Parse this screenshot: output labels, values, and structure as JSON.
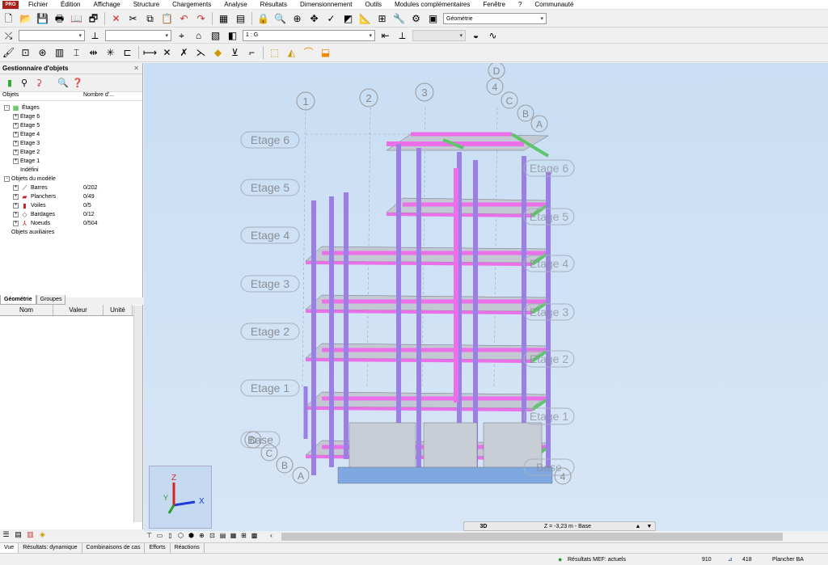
{
  "menu": {
    "logo": "PRO",
    "items": [
      "Fichier",
      "Édition",
      "Affichage",
      "Structure",
      "Chargements",
      "Analyse",
      "Résultats",
      "Dimensionnement",
      "Outils",
      "Modules complémentaires",
      "Fenêtre",
      "?",
      "Communauté"
    ]
  },
  "toolbar": {
    "layout_combo": "Géométrie",
    "case_combo": "1 : G"
  },
  "object_manager": {
    "title": "Gestionnaire d'objets",
    "col_objects": "Objets",
    "col_count": "Nombre d'...",
    "tree": [
      {
        "label": "Étages",
        "level": 0,
        "sign": "-",
        "icon": "floors-icon",
        "count": ""
      },
      {
        "label": "Etage 6",
        "level": 1,
        "sign": "+",
        "icon": "",
        "count": ""
      },
      {
        "label": "Etage 5",
        "level": 1,
        "sign": "+",
        "icon": "",
        "count": ""
      },
      {
        "label": "Etage 4",
        "level": 1,
        "sign": "+",
        "icon": "",
        "count": ""
      },
      {
        "label": "Etage 3",
        "level": 1,
        "sign": "+",
        "icon": "",
        "count": ""
      },
      {
        "label": "Etage 2",
        "level": 1,
        "sign": "+",
        "icon": "",
        "count": ""
      },
      {
        "label": "Etage 1",
        "level": 1,
        "sign": "+",
        "icon": "",
        "count": ""
      },
      {
        "label": "Indéfini",
        "level": 1,
        "sign": "",
        "icon": "",
        "count": ""
      },
      {
        "label": "Objets du modèle",
        "level": 0,
        "sign": "-",
        "icon": "",
        "count": ""
      },
      {
        "label": "Barres",
        "level": 1,
        "sign": "+",
        "icon": "bar-icon",
        "count": "0/202"
      },
      {
        "label": "Planchers",
        "level": 1,
        "sign": "+",
        "icon": "slab-icon",
        "count": "0/49"
      },
      {
        "label": "Voiles",
        "level": 1,
        "sign": "+",
        "icon": "wall-icon",
        "count": "0/5"
      },
      {
        "label": "Bardages",
        "level": 1,
        "sign": "+",
        "icon": "cladding-icon",
        "count": "0/12"
      },
      {
        "label": "Noeuds",
        "level": 1,
        "sign": "+",
        "icon": "node-icon",
        "count": "0/504"
      },
      {
        "label": "Objets auxiliaires",
        "level": 0,
        "sign": "",
        "icon": "",
        "count": ""
      }
    ],
    "tabs": [
      "Géométrie",
      "Groupes"
    ]
  },
  "properties": {
    "col_name": "Nom",
    "col_value": "Valeur",
    "col_unit": "Unité"
  },
  "viewport": {
    "axes_numbers": [
      "1",
      "2",
      "3",
      "4"
    ],
    "axes_letters": [
      "D",
      "C",
      "B",
      "A"
    ],
    "floor_labels_left": [
      "Etage 6",
      "Etage 5",
      "Etage 4",
      "Etage 3",
      "Etage 2",
      "Etage 1",
      "Base"
    ],
    "floor_labels_right": [
      "Etage 6",
      "Etage 5",
      "Etage 4",
      "Etage 3",
      "Etage 2",
      "Etage 1",
      "Base"
    ],
    "axis_triad": {
      "x": "X",
      "y": "Y",
      "z": "Z"
    },
    "view_label": "3D",
    "level_readout": "Z = -3,23 m - Base"
  },
  "bottom_tabs": [
    "Vue",
    "Résultats: dynamique",
    "Combinaisons de cas",
    "Efforts",
    "Réactions"
  ],
  "status": {
    "results": "Résultats MEF: actuels",
    "n1": "910",
    "n2": "418",
    "section": "Plancher BA"
  },
  "colors": {
    "column": "#9b7fe6",
    "beam": "#ea6fe8",
    "slab": "#b6bfca",
    "brace": "#5fc46a",
    "base": "#7fa8e0"
  }
}
